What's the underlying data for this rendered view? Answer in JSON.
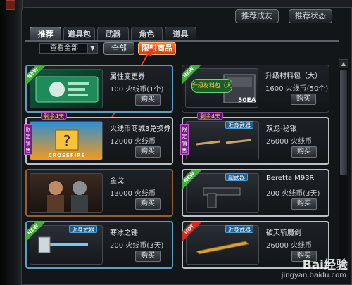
{
  "top_buttons": [
    "推荐成友",
    "推荐状态"
  ],
  "tabs": [
    "推荐",
    "道具包",
    "武器",
    "角色",
    "道具"
  ],
  "filter": {
    "select_value": "查看全部",
    "all_label": "全部",
    "limited_label": "限时商品"
  },
  "items": [
    {
      "name": "属性变更券",
      "price": "100 火线币(1个)",
      "buy": "购买",
      "badge": "NEW",
      "tag": "",
      "limit": ""
    },
    {
      "name": "升级材料包（大）",
      "price": "1600 火线币(50个)",
      "buy": "购买",
      "badge": "NEW",
      "tag": "",
      "limit": "",
      "thumb_text": "升级材料包（大）",
      "thumb_qty": "50EA"
    },
    {
      "name": "火线币商城3兑换券",
      "price": "12000 火线币",
      "buy": "购买",
      "badge": "",
      "tag": "",
      "limit": "剩余4天",
      "side_label": "限定销售",
      "thumb_text": "CROSSFIRE"
    },
    {
      "name": "双龙-秘银",
      "price": "26000 火线币",
      "buy": "购买",
      "badge": "",
      "tag": "近身武器",
      "limit": "剩余4天",
      "side_label": "限定销售"
    },
    {
      "name": "金戈",
      "price": "13000 火线币",
      "buy": "购买",
      "badge": "",
      "tag": "",
      "limit": ""
    },
    {
      "name": "Beretta M93R",
      "price": "200 火线币(3天)",
      "buy": "购买",
      "badge": "NEW",
      "tag": "副武器",
      "limit": ""
    },
    {
      "name": "寒冰之锤",
      "price": "200 火线币(3天)",
      "buy": "购买",
      "badge": "NEW",
      "tag": "近身武器",
      "limit": ""
    },
    {
      "name": "破天斩魔剑",
      "price": "26000 火线币",
      "buy": "购买",
      "badge": "HOT",
      "tag": "近身武器",
      "limit": ""
    }
  ],
  "watermark": {
    "main": "Bai经验",
    "sub": "jingyan.baidu.com"
  },
  "colors": {
    "accent_orange": "#ff7a2a",
    "highlight_blue": "#5b9fc0",
    "new_green": "#3fae3a",
    "hot_red": "#d62b1a",
    "limited_purple": "#7a1f8a"
  }
}
